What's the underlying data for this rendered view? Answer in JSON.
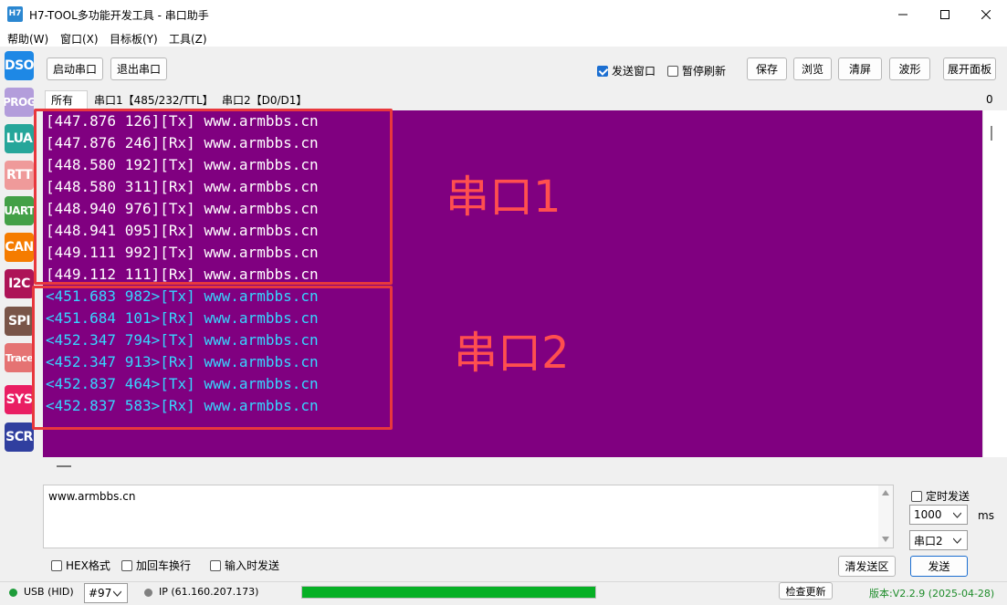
{
  "window": {
    "title": "H7-TOOL多功能开发工具 - 串口助手",
    "icon_label": "H7"
  },
  "menu": [
    "帮助(W)",
    "窗口(X)",
    "目标板(Y)",
    "工具(Z)"
  ],
  "sidebar": [
    {
      "label": "DSO",
      "color": "#1e88e5"
    },
    {
      "label": "PROG",
      "color": "#b39ddb"
    },
    {
      "label": "LUA",
      "color": "#26a69a"
    },
    {
      "label": "RTT",
      "color": "#ef9a9a"
    },
    {
      "label": "UART",
      "color": "#43a047"
    },
    {
      "label": "CAN",
      "color": "#f57c00"
    },
    {
      "label": "I2C",
      "color": "#ad1457"
    },
    {
      "label": "SPI",
      "color": "#795548"
    },
    {
      "label": "Trace",
      "color": "#e57373"
    },
    {
      "label": "SYS",
      "color": "#e91e63"
    },
    {
      "label": "SCR",
      "color": "#303f9f"
    }
  ],
  "toolbar": {
    "start_port": "启动串口",
    "exit_port": "退出串口",
    "send_window": {
      "label": "发送窗口",
      "checked": true
    },
    "pause_refresh": {
      "label": "暂停刷新",
      "checked": false
    },
    "save": "保存",
    "browse": "浏览",
    "clear": "清屏",
    "waveform": "波形",
    "expand_panel": "展开面板"
  },
  "tabs": [
    "所有",
    "串口1【485/232/TTL】",
    "串口2【D0/D1】"
  ],
  "tab_counter": "0",
  "terminal": {
    "background": "#800080",
    "port1_color": "#ffffff",
    "port2_color": "#36d6ff",
    "port1_lines": [
      "[447.876 126][Tx] www.armbbs.cn",
      "[447.876 246][Rx] www.armbbs.cn",
      "[448.580 192][Tx] www.armbbs.cn",
      "[448.580 311][Rx] www.armbbs.cn",
      "[448.940 976][Tx] www.armbbs.cn",
      "[448.941 095][Rx] www.armbbs.cn",
      "[449.111 992][Tx] www.armbbs.cn",
      "[449.112 111][Rx] www.armbbs.cn"
    ],
    "port2_lines": [
      "<451.683 982>[Tx] www.armbbs.cn",
      "<451.684 101>[Rx] www.armbbs.cn",
      "<452.347 794>[Tx] www.armbbs.cn",
      "<452.347 913>[Rx] www.armbbs.cn",
      "<452.837 464>[Tx] www.armbbs.cn",
      "<452.837 583>[Rx] www.armbbs.cn"
    ],
    "annotation1": "串口1",
    "annotation2": "串口2"
  },
  "send": {
    "text": "www.armbbs.cn",
    "timed_send": {
      "label": "定时发送",
      "checked": false
    },
    "interval": "1000",
    "interval_unit": "ms",
    "port": "串口2",
    "hex_format": {
      "label": "HEX格式",
      "checked": false
    },
    "add_newline": {
      "label": "加回车换行",
      "checked": false
    },
    "send_on_input": {
      "label": "输入时发送",
      "checked": false
    },
    "clear_send": "清发送区",
    "send_button": "发送"
  },
  "status": {
    "usb": "USB (HID)",
    "usb_color": "#1e9c3a",
    "device": "#97",
    "ip": "IP (61.160.207.173)",
    "ip_color": "#808080",
    "progress": 1.0,
    "check_update": "检查更新",
    "version": "版本:V2.2.9 (2025-04-28)",
    "version_color": "#1e8c2a"
  }
}
